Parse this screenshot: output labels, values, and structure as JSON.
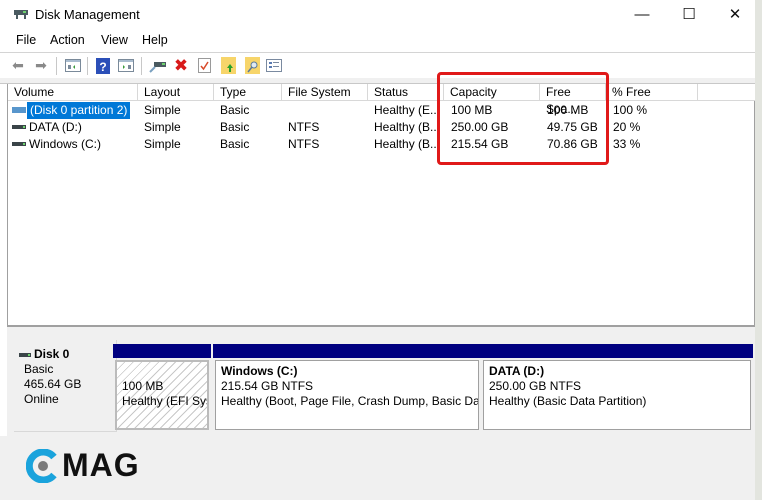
{
  "window": {
    "title": "Disk Management",
    "controls": {
      "minimize": "—",
      "maximize": "☐",
      "close": "✕"
    }
  },
  "menu": [
    "File",
    "Action",
    "View",
    "Help"
  ],
  "toolbar": {
    "icons": [
      "back-icon",
      "forward-icon",
      "show-hide-console-tree-icon",
      "help-icon",
      "show-hide-action-pane-icon",
      "connect-disk-icon",
      "delete-icon",
      "properties-icon",
      "import-folder-icon",
      "search-folder-icon",
      "settings-list-icon"
    ]
  },
  "volume_table": {
    "columns": [
      "Volume",
      "Layout",
      "Type",
      "File System",
      "Status",
      "Capacity",
      "Free Spa...",
      "% Free"
    ],
    "rows": [
      {
        "volume": "(Disk 0 partition 2)",
        "layout": "Simple",
        "type": "Basic",
        "file_system": "",
        "status": "Healthy (E...",
        "capacity": "100 MB",
        "free_space": "100 MB",
        "percent_free": "100 %",
        "selected": true,
        "icon": "striped-volume-icon"
      },
      {
        "volume": "DATA (D:)",
        "layout": "Simple",
        "type": "Basic",
        "file_system": "NTFS",
        "status": "Healthy (B...",
        "capacity": "250.00 GB",
        "free_space": "49.75 GB",
        "percent_free": "20 %",
        "selected": false,
        "icon": "volume-icon"
      },
      {
        "volume": "Windows (C:)",
        "layout": "Simple",
        "type": "Basic",
        "file_system": "NTFS",
        "status": "Healthy (B...",
        "capacity": "215.54 GB",
        "free_space": "70.86 GB",
        "percent_free": "33 %",
        "selected": false,
        "icon": "volume-icon"
      }
    ]
  },
  "disk": {
    "name": "Disk 0",
    "type": "Basic",
    "size": "465.64 GB",
    "state": "Online",
    "partitions": [
      {
        "title": "",
        "line1": "100 MB",
        "line2": "Healthy (EFI Sys",
        "hatched": true
      },
      {
        "title": "Windows  (C:)",
        "line1": "215.54 GB NTFS",
        "line2": "Healthy (Boot, Page File, Crash Dump, Basic Dat",
        "hatched": false
      },
      {
        "title": "DATA  (D:)",
        "line1": "250.00 GB NTFS",
        "line2": "Healthy (Basic Data Partition)",
        "hatched": false
      }
    ]
  },
  "watermark": {
    "text": "MAG",
    "accent": "#1aa3dc"
  },
  "colors": {
    "highlight": "#e01919",
    "partition_bar": "#000080",
    "selection": "#0078d7"
  }
}
